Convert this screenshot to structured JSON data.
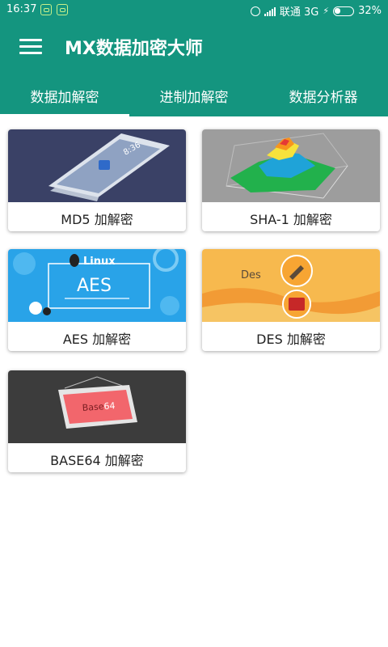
{
  "status_bar": {
    "time": "16:37",
    "carrier": "联通 3G",
    "battery_percent": "32%",
    "battery_level": 0.32,
    "icons": [
      "android-icon",
      "android-icon",
      "alarm-icon",
      "signal-icon",
      "charging-bolt-icon",
      "battery-icon"
    ]
  },
  "app_bar": {
    "title": "MX数据加密大师",
    "menu_icon": "hamburger-menu-icon"
  },
  "tabs": [
    {
      "label": "数据加解密",
      "active": true
    },
    {
      "label": "进制加解密",
      "active": false
    },
    {
      "label": "数据分析器",
      "active": false
    }
  ],
  "cards": [
    {
      "label": "MD5 加解密",
      "image": "phone-illustration",
      "phone_time": "8:36"
    },
    {
      "label": "SHA-1 加解密",
      "image": "3d-surface-plot"
    },
    {
      "label": "AES 加解密",
      "image": "linux-aes-banner",
      "banner_title": "Linux",
      "banner_text": "AES"
    },
    {
      "label": "DES 加解密",
      "image": "des-banner",
      "banner_text": "Des"
    },
    {
      "label": "BASE64 加解密",
      "image": "base64-frame",
      "frame_text_a": "Base",
      "frame_text_b": "64"
    }
  ],
  "colors": {
    "primary": "#14957f",
    "text_dark": "#222222"
  }
}
